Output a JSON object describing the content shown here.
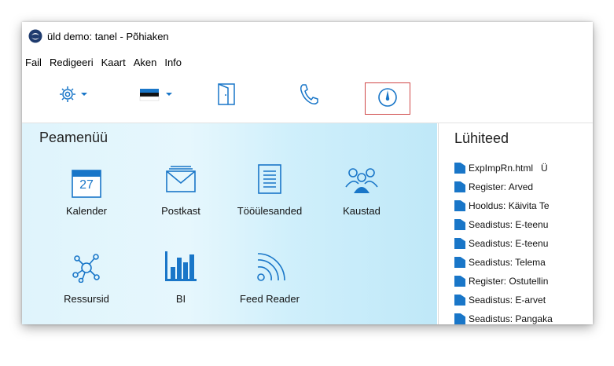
{
  "window": {
    "title": "üld demo: tanel - Põhiaken"
  },
  "menu": [
    "Fail",
    "Redigeeri",
    "Kaart",
    "Aken",
    "Info"
  ],
  "toolbar": {
    "items": [
      "gear-dropdown",
      "flag-dropdown",
      "door",
      "phone",
      "compass"
    ],
    "highlighted": "compass",
    "highlight_color": "#d04848"
  },
  "main_menu": {
    "title": "Peamenüü",
    "tiles": [
      {
        "label": "Kalender",
        "icon": "calendar-icon",
        "day": "27"
      },
      {
        "label": "Postkast",
        "icon": "mail-icon"
      },
      {
        "label": "Tööülesanded",
        "icon": "task-list-icon"
      },
      {
        "label": "Kaustad",
        "icon": "people-group-icon"
      },
      {
        "label": "Ressursid",
        "icon": "network-icon"
      },
      {
        "label": "BI",
        "icon": "bar-chart-icon"
      },
      {
        "label": "Feed Reader",
        "icon": "rss-icon"
      }
    ]
  },
  "shortcuts": {
    "title": "Lühiteed",
    "items": [
      "ExpImpRn.html   Ü",
      "Register: Arved",
      "Hooldus: Käivita Te",
      "Seadistus: E-teenu",
      "Seadistus: E-teenu",
      "Seadistus: Telema",
      "Register: Ostutellin",
      "Seadistus: E-arvet",
      "Seadistus: Pangaka"
    ]
  },
  "colors": {
    "accent": "#1976c8",
    "panel_bg": "#dff4fc"
  }
}
